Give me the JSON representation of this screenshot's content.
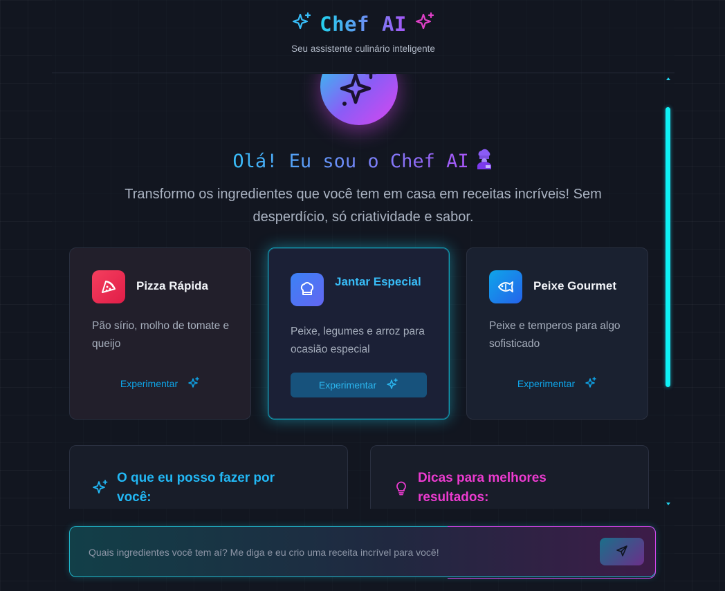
{
  "header": {
    "title": "Chef AI",
    "subtitle": "Seu assistente culinário inteligente"
  },
  "hero": {
    "greeting": "Olá! Eu sou o Chef AI",
    "intro": "Transformo os ingredientes que você tem em casa em receitas incríveis! Sem desperdício, só criatividade e sabor."
  },
  "cards": [
    {
      "title": "Pizza Rápida",
      "description": "Pão sírio, molho de tomate e queijo",
      "button": "Experimentar",
      "icon": "pizza-icon"
    },
    {
      "title": "Jantar Especial",
      "description": "Peixe, legumes e arroz para ocasião especial",
      "button": "Experimentar",
      "icon": "chef-hat-icon"
    },
    {
      "title": "Peixe Gourmet",
      "description": "Peixe e temperos para algo sofisticado",
      "button": "Experimentar",
      "icon": "fish-icon"
    }
  ],
  "sections": [
    {
      "title": "O que eu posso fazer por você:",
      "icon": "sparkles-icon"
    },
    {
      "title": "Dicas para melhores resultados:",
      "icon": "lightbulb-icon"
    }
  ],
  "chat": {
    "placeholder": "Quais ingredientes você tem aí? Me diga e eu crio uma receita incrível para você!",
    "send_icon": "send-icon"
  },
  "colors": {
    "accent_cyan": "#22d3ee",
    "accent_purple": "#a855f7",
    "accent_magenta": "#d946ef",
    "background": "#121620"
  }
}
